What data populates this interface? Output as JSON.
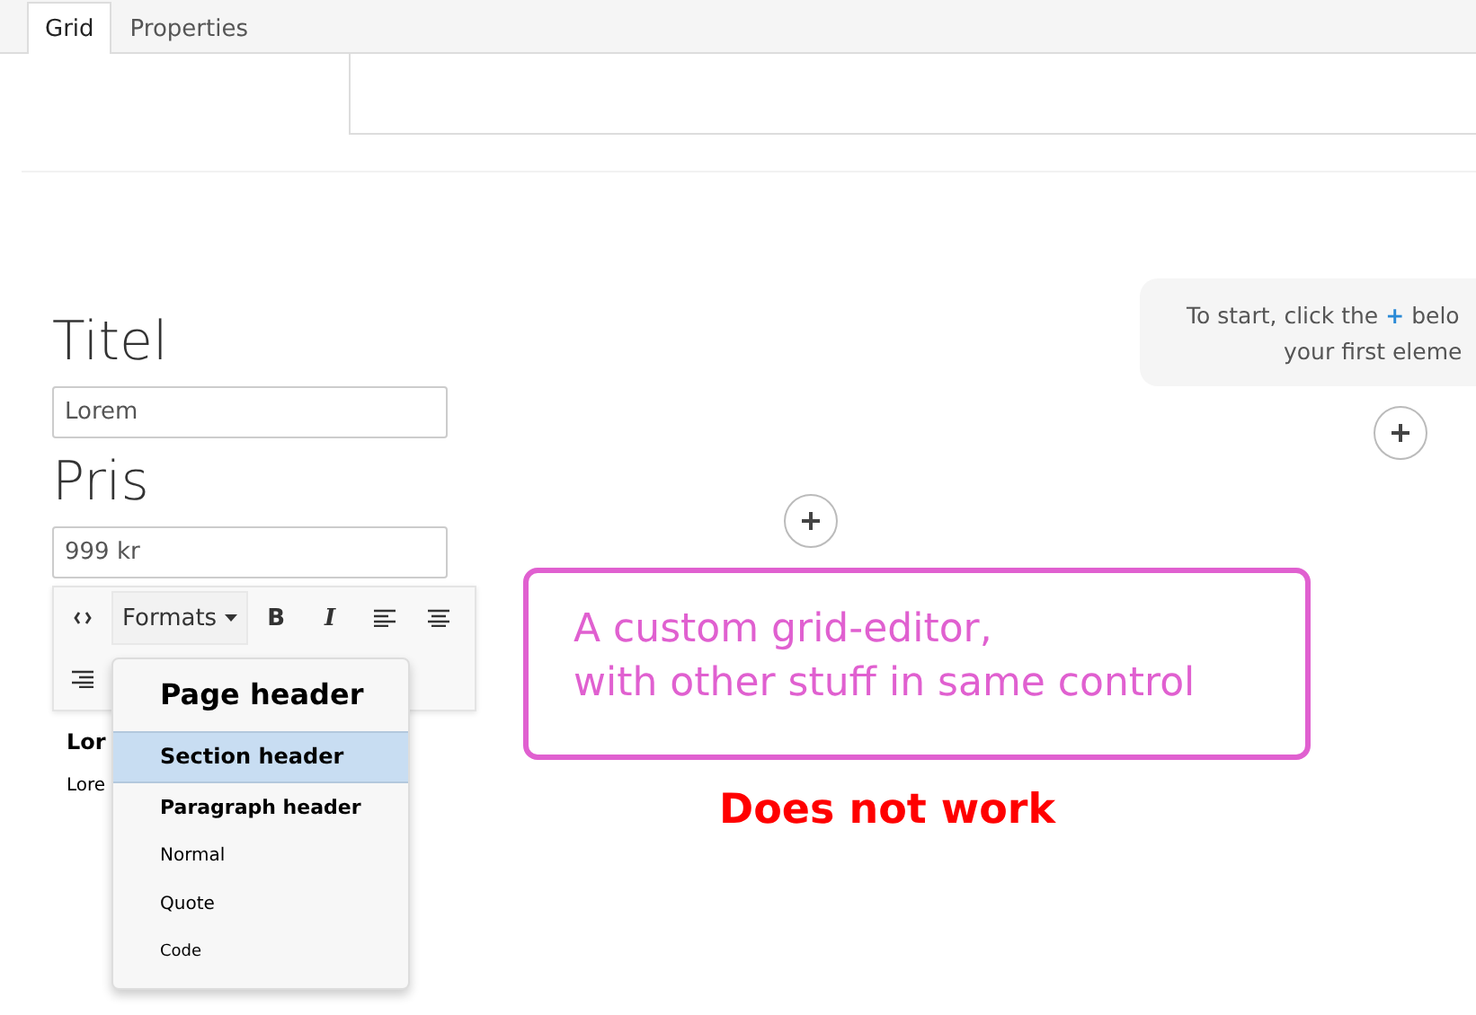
{
  "tabs": [
    {
      "label": "Grid",
      "selected": true
    },
    {
      "label": "Properties",
      "selected": false
    }
  ],
  "fields": [
    {
      "label": "Titel",
      "value": "Lorem"
    },
    {
      "label": "Pris",
      "value": "999 kr"
    }
  ],
  "toolbar": {
    "formats_label": "Formats",
    "bold": "B",
    "italic": "I"
  },
  "formats_menu": [
    {
      "label": "Page header",
      "kind": "h1",
      "selected": false
    },
    {
      "label": "Section header",
      "kind": "h2",
      "selected": true
    },
    {
      "label": "Paragraph header",
      "kind": "h3",
      "selected": false
    },
    {
      "label": "Normal",
      "kind": "p",
      "selected": false
    },
    {
      "label": "Quote",
      "kind": "quote",
      "selected": false
    },
    {
      "label": "Code",
      "kind": "code",
      "selected": false
    }
  ],
  "editor_content": [
    "Lor",
    "Lore"
  ],
  "hint": {
    "line1_start": "To start, click the",
    "plus": "+",
    "line1_end": "belo",
    "line2": "your first eleme"
  },
  "annotation": {
    "lines": [
      "A custom grid-editor,",
      "with other stuff in same control"
    ],
    "verdict": "Does not work"
  }
}
